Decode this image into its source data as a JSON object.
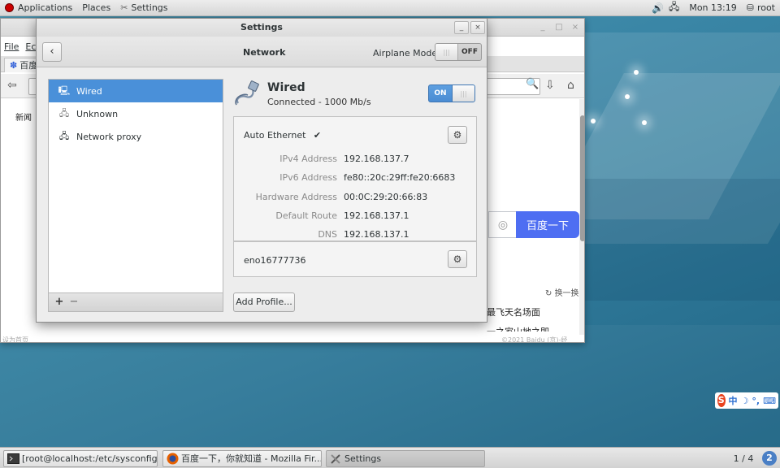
{
  "topbar": {
    "applications": "Applications",
    "places": "Places",
    "settings": "Settings",
    "clock": "Mon 13:19",
    "user": "root"
  },
  "firefox": {
    "menu_file": "File",
    "menu_edit": "Ec",
    "tab_title": "百度",
    "news": "新闻",
    "search_button": "百度一下",
    "refresh": "换一换",
    "hot1": "最飞天名场面",
    "hot2": "一之家山地之即",
    "footer_left": "设为首页",
    "footer_copy": "©2021 Baidu  (京)-经"
  },
  "settings": {
    "window_title": "Settings",
    "header_title": "Network",
    "airplane_label": "Airplane Mode",
    "airplane_state": "OFF",
    "sidebar": [
      {
        "label": "Wired",
        "icon": "wired-icon"
      },
      {
        "label": "Unknown",
        "icon": "network-icon"
      },
      {
        "label": "Network proxy",
        "icon": "proxy-icon"
      }
    ],
    "add_symbol": "+",
    "remove_symbol": "−",
    "device": {
      "name": "Wired",
      "status": "Connected - 1000 Mb/s",
      "switch_state": "ON"
    },
    "profile": {
      "name": "Auto Ethernet",
      "check": "✔",
      "details": [
        {
          "key": "IPv4 Address",
          "value": "192.168.137.7"
        },
        {
          "key": "IPv6 Address",
          "value": "fe80::20c:29ff:fe20:6683"
        },
        {
          "key": "Hardware Address",
          "value": "00:0C:29:20:66:83"
        },
        {
          "key": "Default Route",
          "value": "192.168.137.1"
        },
        {
          "key": "DNS",
          "value": "192.168.137.1"
        }
      ]
    },
    "profile2": {
      "name": "eno16777736"
    },
    "add_profile": "Add Profile..."
  },
  "ime": {
    "label": "中"
  },
  "taskbar": {
    "tasks": [
      {
        "label": "[root@localhost:/etc/sysconfig/...",
        "icon": "terminal-icon"
      },
      {
        "label": "百度一下，你就知道 - Mozilla Fir...",
        "icon": "firefox-icon"
      },
      {
        "label": "Settings",
        "icon": "settings-icon"
      }
    ],
    "pager": "1 / 4",
    "pager_badge": "2"
  },
  "colors": {
    "selection": "#4a90d9",
    "switch_on": "#4a8cd3",
    "baidu_blue": "#4e6ef2"
  }
}
